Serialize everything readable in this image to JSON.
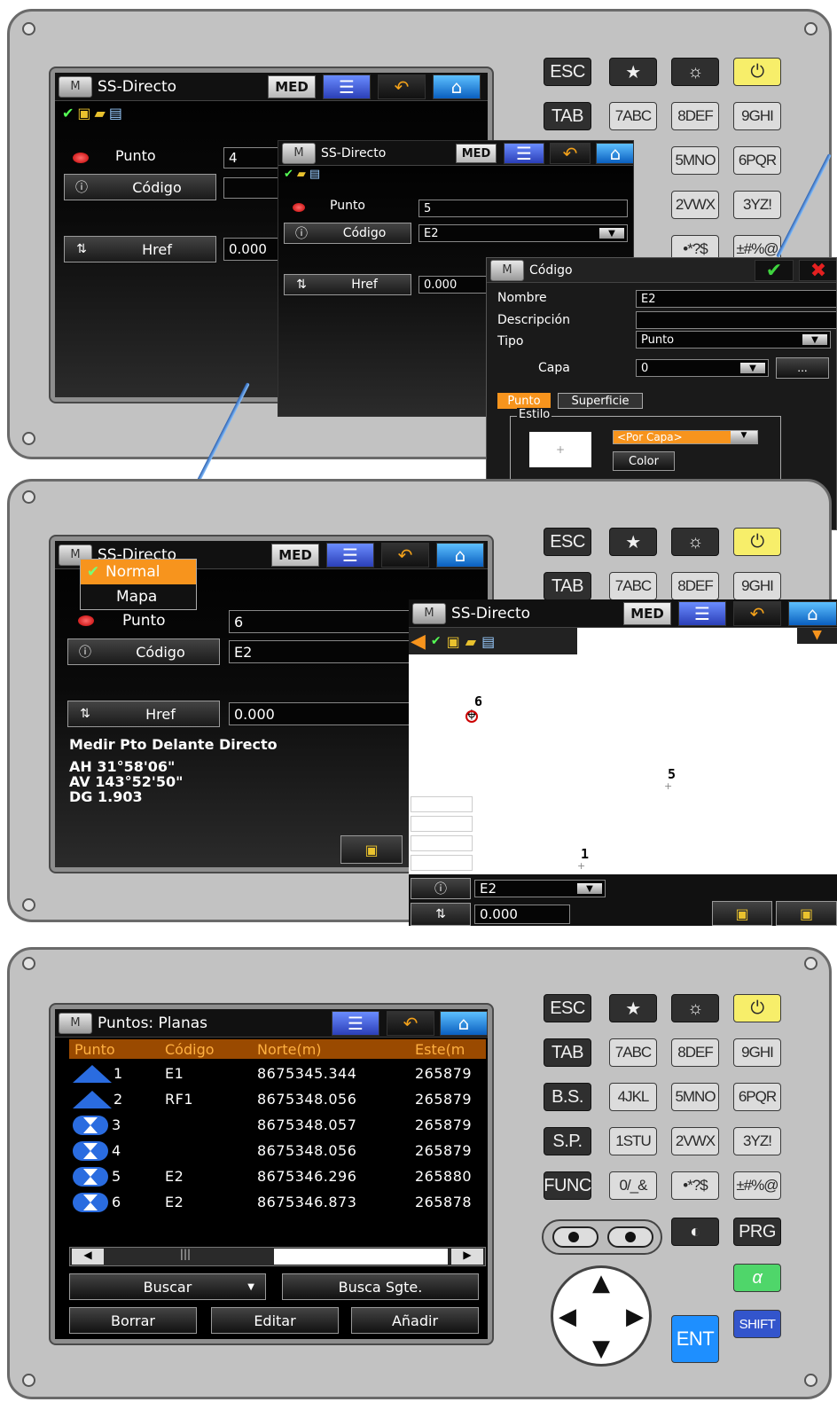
{
  "panel1": {
    "main": {
      "title": "SS-Directo",
      "med": "MED",
      "punto_label": "Punto",
      "punto_value": "4",
      "codigo_label": "Código",
      "codigo_value": "",
      "href_label": "Href",
      "href_value": "0.000"
    },
    "overlay": {
      "title": "SS-Directo",
      "med": "MED",
      "punto_label": "Punto",
      "punto_value": "5",
      "codigo_label": "Código",
      "codigo_value": "E2",
      "href_label": "Href",
      "href_value": "0.000"
    },
    "dialog": {
      "title": "Código",
      "nombre_label": "Nombre",
      "nombre_value": "E2",
      "descripcion_label": "Descripción",
      "descripcion_value": "",
      "tipo_label": "Tipo",
      "tipo_value": "Punto",
      "capa_label": "Capa",
      "capa_value": "0",
      "capa_more": "...",
      "tab_punto": "Punto",
      "tab_superficie": "Superficie",
      "estilo_label": "Estilo",
      "estilo_value": "<Por Capa>",
      "color_button": "Color"
    }
  },
  "panel2": {
    "main": {
      "title": "SS-Directo",
      "med": "MED",
      "menu_items": [
        "Normal",
        "Mapa"
      ],
      "punto_label": "Punto",
      "punto_value": "6",
      "codigo_label": "Código",
      "codigo_value": "E2",
      "href_label": "Href",
      "href_value": "0.000",
      "measure_title": "Medir Pto Delante Directo",
      "ah": "AH 31°58'06\"",
      "av": "AV 143°52'50\"",
      "dg": "DG 1.903"
    },
    "map": {
      "title": "SS-Directo",
      "med": "MED",
      "points": [
        {
          "label": "6",
          "current": true
        },
        {
          "label": "5",
          "current": false
        },
        {
          "label": "1",
          "current": false
        }
      ],
      "codigo_value": "E2",
      "href_value": "0.000"
    }
  },
  "panel3": {
    "title": "Puntos: Planas",
    "columns": [
      "Punto",
      "Código",
      "Norte(m)",
      "Este(m"
    ],
    "rows": [
      {
        "punto": "1",
        "codigo": "E1",
        "norte": "8675345.344",
        "este": "265879",
        "icon": "triangle"
      },
      {
        "punto": "2",
        "codigo": "RF1",
        "norte": "8675348.056",
        "este": "265879",
        "icon": "triangle"
      },
      {
        "punto": "3",
        "codigo": "",
        "norte": "8675348.057",
        "este": "265879",
        "icon": "cross-circle"
      },
      {
        "punto": "4",
        "codigo": "",
        "norte": "8675348.056",
        "este": "265879",
        "icon": "cross-circle"
      },
      {
        "punto": "5",
        "codigo": "E2",
        "norte": "8675346.296",
        "este": "265880",
        "icon": "cross-circle"
      },
      {
        "punto": "6",
        "codigo": "E2",
        "norte": "8675346.873",
        "este": "265878",
        "icon": "cross-circle"
      }
    ],
    "buscar": "Buscar",
    "busca_sgte": "Busca Sgte.",
    "borrar": "Borrar",
    "editar": "Editar",
    "anadir": "Añadir"
  },
  "keypad": {
    "esc": "ESC",
    "star": "★",
    "light": "☼",
    "power": "⏻",
    "tab": "TAB",
    "k7": "7ABC",
    "k8": "8DEF",
    "k9": "9GHI",
    "bs": "B.S.",
    "k4": "4JKL",
    "k5": "5MNO",
    "k6": "6PQR",
    "sp": "S.P.",
    "k1": "1STU",
    "k2": "2VWX",
    "k3": "3YZ!",
    "func": "FUNC",
    "k0": "0/_&",
    "dot": "•*?$",
    "pm": "±#%@",
    "prg": "PRG",
    "alpha": "α",
    "shift": "SHIFT",
    "ent": "ENT"
  },
  "colors": {
    "device": "#c2c2c2",
    "orange": "#f7941d",
    "table_header": "#9a4a00",
    "blue_icon": "#2a6ce0",
    "ent": "#1e8fff"
  }
}
